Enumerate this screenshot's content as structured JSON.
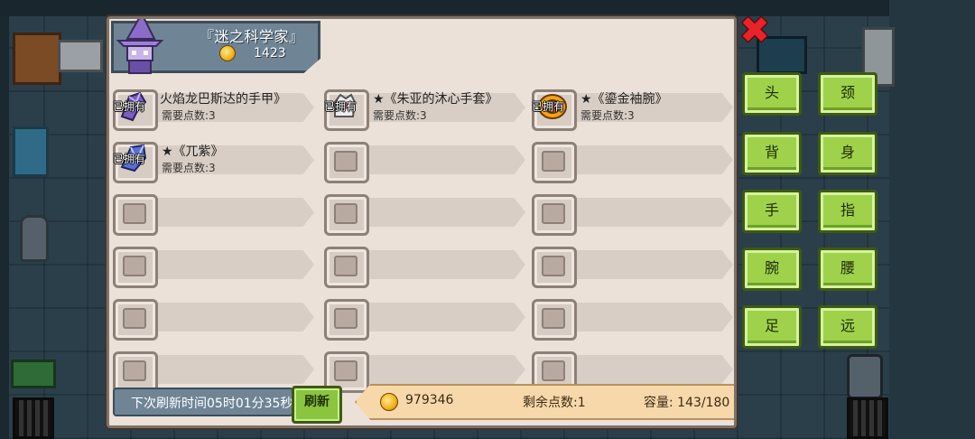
{
  "shop": {
    "title": "『迷之科学家』",
    "coins": "1423"
  },
  "owned_label": "已拥有",
  "items": [
    {
      "name": "火焰龙巴斯达的手甲》",
      "req": "需要点数:3",
      "owned": true,
      "icon": "gauntlet-icon",
      "color": "#7a5ec2"
    },
    {
      "name": "★《朱亚的沐心手套》",
      "req": "需要点数:3",
      "owned": true,
      "icon": "glove-icon",
      "color": "#e2e2ea"
    },
    {
      "name": "★《鎏金袖腕》",
      "req": "需要点数:3",
      "owned": true,
      "icon": "bracer-icon",
      "color": "#f0a020"
    },
    {
      "name": "★《兀紫》",
      "req": "需要点数:3",
      "owned": true,
      "icon": "claw-icon",
      "color": "#5a6fd0"
    }
  ],
  "footer": {
    "refresh_time": "下次刷新时间05时01分35秒",
    "refresh_button": "刷新",
    "money": "979346",
    "points": "剩余点数:1",
    "capacity": "容量: 143/180"
  },
  "filters": [
    "头",
    "颈",
    "背",
    "身",
    "手",
    "指",
    "腕",
    "腰",
    "足",
    "远"
  ],
  "colors": {
    "panel": "#ebe1d9",
    "filter_green": "#9fd24a",
    "close_red": "#e8232a"
  }
}
